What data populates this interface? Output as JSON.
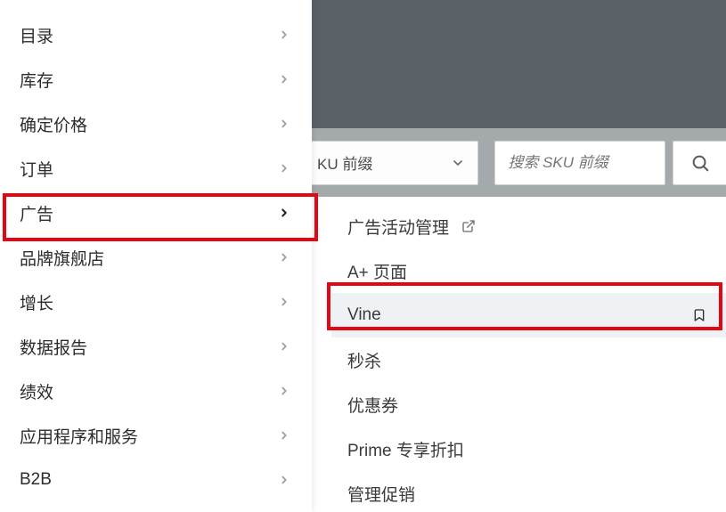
{
  "search": {
    "dropdown_label": "KU 前缀",
    "placeholder": "搜索 SKU 前缀"
  },
  "sidebar": {
    "items": [
      {
        "label": "目录"
      },
      {
        "label": "库存"
      },
      {
        "label": "确定价格"
      },
      {
        "label": "订单"
      },
      {
        "label": "广告",
        "active": true
      },
      {
        "label": "品牌旗舰店"
      },
      {
        "label": "增长"
      },
      {
        "label": "数据报告"
      },
      {
        "label": "绩效"
      },
      {
        "label": "应用程序和服务"
      },
      {
        "label": "B2B"
      }
    ]
  },
  "submenu": {
    "parent": "广告",
    "items": [
      {
        "label": "广告活动管理",
        "external": true
      },
      {
        "label": "A+ 页面"
      },
      {
        "label": "Vine",
        "hover": true,
        "bookmark": true
      },
      {
        "label": "秒杀"
      },
      {
        "label": "优惠券"
      },
      {
        "label": "Prime 专享折扣"
      },
      {
        "label": "管理促销"
      }
    ]
  }
}
